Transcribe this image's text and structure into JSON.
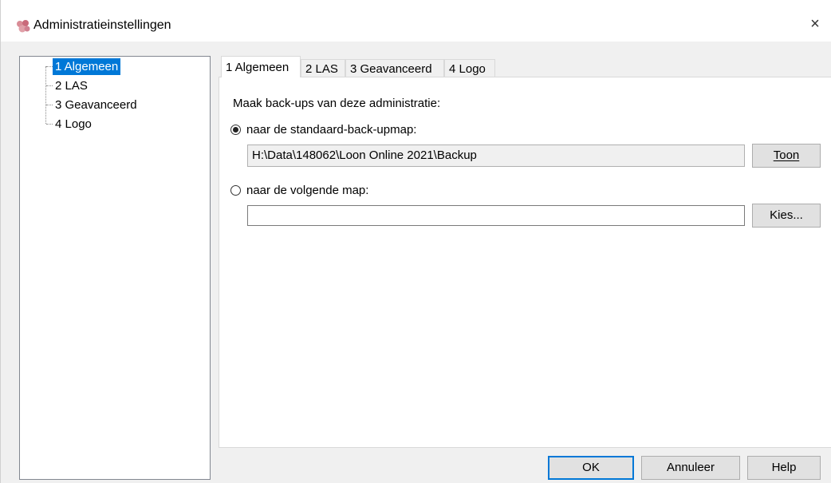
{
  "window": {
    "title": "Administratieinstellingen",
    "close_glyph": "×",
    "app_icon": "app-logo-icon"
  },
  "tree": {
    "items": [
      {
        "label": "1 Algemeen",
        "selected": true
      },
      {
        "label": "2 LAS",
        "selected": false
      },
      {
        "label": "3 Geavanceerd",
        "selected": false
      },
      {
        "label": "4 Logo",
        "selected": false
      }
    ]
  },
  "tabs": [
    {
      "label": "1 Algemeen",
      "active": true
    },
    {
      "label": "2 LAS",
      "active": false
    },
    {
      "label": "3 Geavanceerd",
      "active": false
    },
    {
      "label": "4 Logo",
      "active": false
    }
  ],
  "general": {
    "backup_label": "Maak back-ups van deze administratie:",
    "option_default": {
      "label": "naar de standaard-back-upmap:",
      "checked": true,
      "path": "H:\\Data\\148062\\Loon Online 2021\\Backup",
      "button_label": "Toon"
    },
    "option_custom": {
      "label": "naar de volgende map:",
      "checked": false,
      "value": "",
      "button_label": "Kies..."
    }
  },
  "footer": {
    "ok_label": "OK",
    "cancel_label": "Annuleer",
    "help_label": "Help"
  },
  "colors": {
    "selection": "#0078d7",
    "window_bg": "#f0f0f0"
  }
}
